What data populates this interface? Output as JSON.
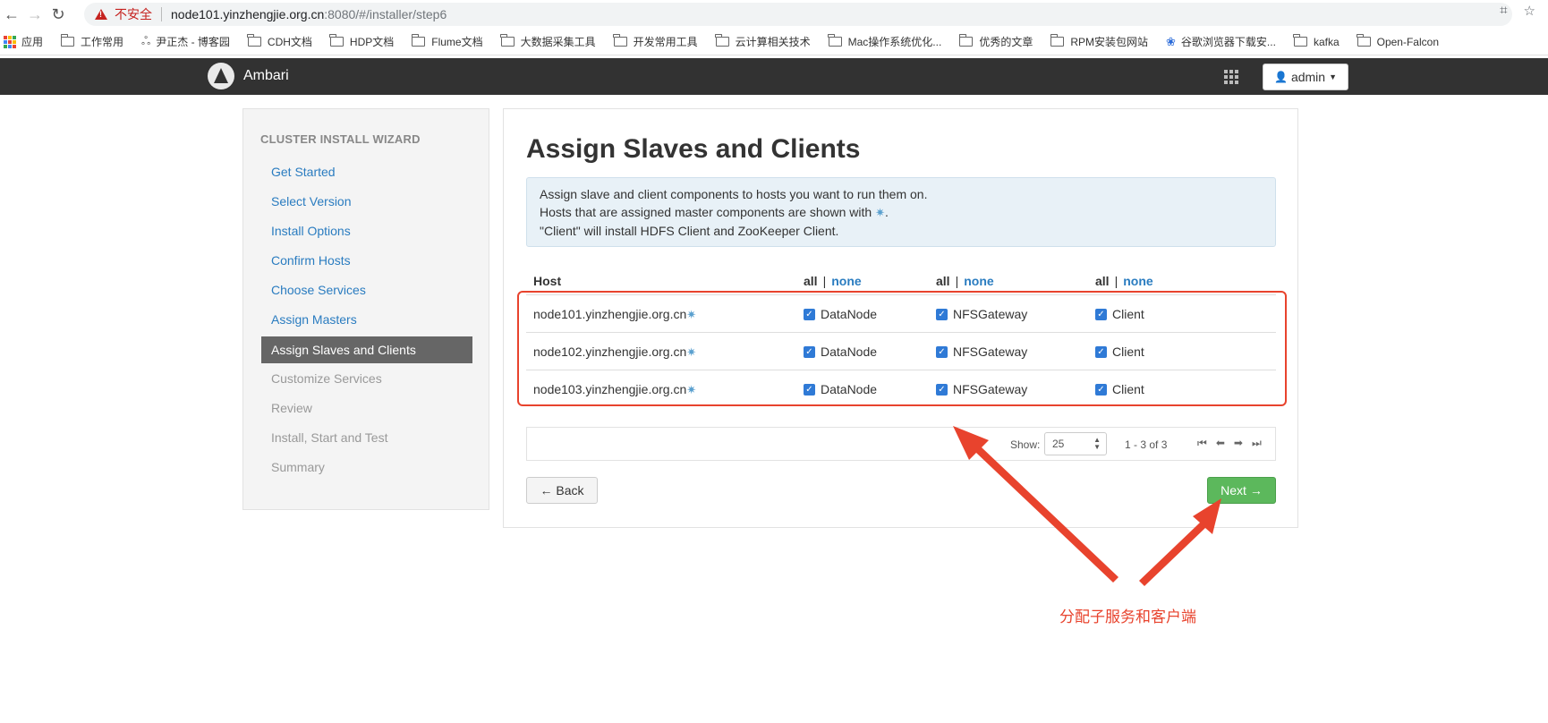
{
  "browser": {
    "insecure_label": "不安全",
    "url_host": "node101.yinzhengjie.org.cn",
    "url_rest": ":8080/#/installer/step6",
    "bookmarks": [
      "应用",
      "工作常用",
      "尹正杰 - 博客园",
      "CDH文档",
      "HDP文档",
      "Flume文档",
      "大数据采集工具",
      "开发常用工具",
      "云计算相关技术",
      "Mac操作系统优化...",
      "优秀的文章",
      "RPM安装包网站",
      "谷歌浏览器下载安...",
      "kafka",
      "Open-Falcon"
    ]
  },
  "topbar": {
    "brand": "Ambari",
    "user": "admin"
  },
  "sidebar": {
    "title": "CLUSTER INSTALL WIZARD",
    "steps": [
      {
        "label": "Get Started",
        "state": "done"
      },
      {
        "label": "Select Version",
        "state": "done"
      },
      {
        "label": "Install Options",
        "state": "done"
      },
      {
        "label": "Confirm Hosts",
        "state": "done"
      },
      {
        "label": "Choose Services",
        "state": "done"
      },
      {
        "label": "Assign Masters",
        "state": "done"
      },
      {
        "label": "Assign Slaves and Clients",
        "state": "active"
      },
      {
        "label": "Customize Services",
        "state": "todo"
      },
      {
        "label": "Review",
        "state": "todo"
      },
      {
        "label": "Install, Start and Test",
        "state": "todo"
      },
      {
        "label": "Summary",
        "state": "todo"
      }
    ]
  },
  "main": {
    "title": "Assign Slaves and Clients",
    "info_line1": "Assign slave and client components to hosts you want to run them on.",
    "info_line2": "Hosts that are assigned master components are shown with",
    "info_star": "✷",
    "info_line2_end": ".",
    "info_line3": "\"Client\" will install HDFS Client and ZooKeeper Client.",
    "table": {
      "host_header": "Host",
      "all_label": "all",
      "pipe": "|",
      "none_label": "none",
      "rows": [
        {
          "host": "node101.yinzhengjie.org.cn",
          "c1": "DataNode",
          "c2": "NFSGateway",
          "c3": "Client"
        },
        {
          "host": "node102.yinzhengjie.org.cn",
          "c1": "DataNode",
          "c2": "NFSGateway",
          "c3": "Client"
        },
        {
          "host": "node103.yinzhengjie.org.cn",
          "c1": "DataNode",
          "c2": "NFSGateway",
          "c3": "Client"
        }
      ]
    },
    "pager": {
      "show_label": "Show:",
      "show_value": "25",
      "range": "1 - 3 of 3"
    },
    "back_label": "← Back",
    "next_label": "Next →"
  },
  "annotation": {
    "text": "分配子服务和客户端",
    "color": "#e8432d"
  },
  "colors": {
    "link": "#2a7cc0",
    "topbar": "#323232",
    "next": "#5cb85c",
    "checkbox": "#2f7ad6"
  }
}
